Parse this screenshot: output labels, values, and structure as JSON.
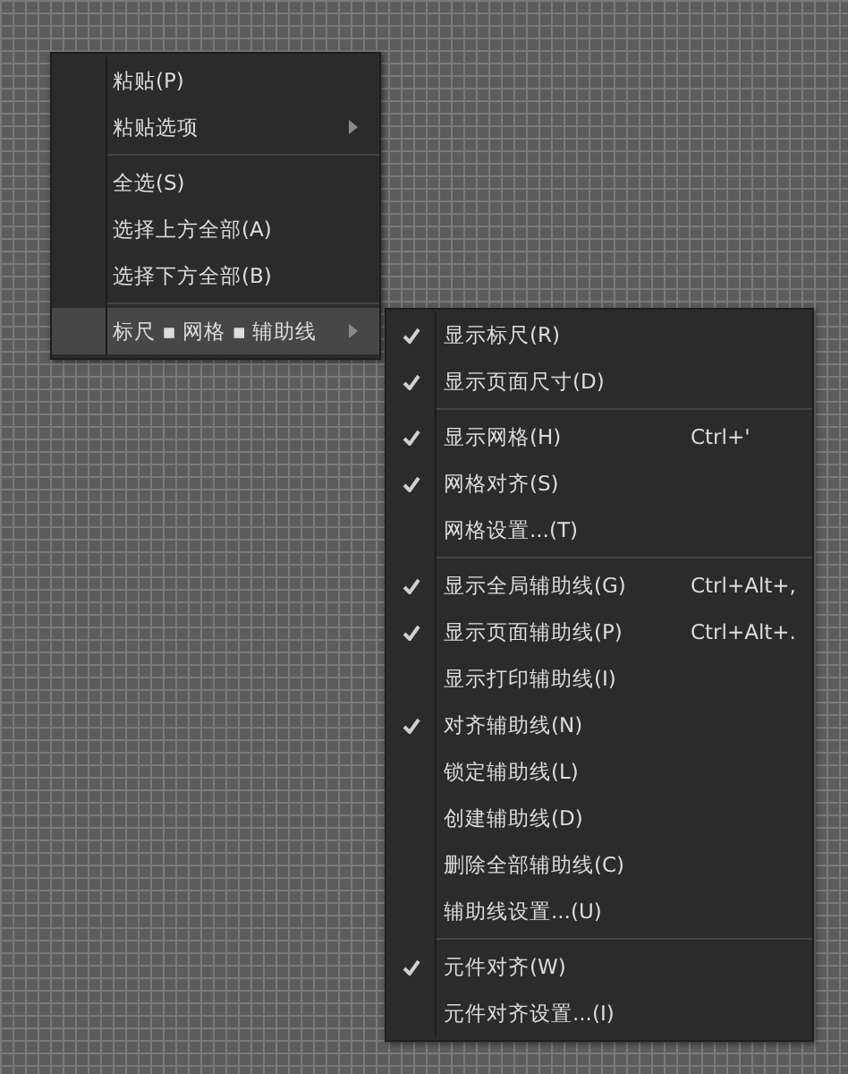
{
  "context_menu": {
    "items": [
      {
        "kind": "item",
        "label": "粘贴(P)",
        "has_submenu": false,
        "highlighted": false
      },
      {
        "kind": "item",
        "label": "粘贴选项",
        "has_submenu": true,
        "highlighted": false
      },
      {
        "kind": "separator"
      },
      {
        "kind": "item",
        "label": "全选(S)",
        "has_submenu": false,
        "highlighted": false
      },
      {
        "kind": "item",
        "label": "选择上方全部(A)",
        "has_submenu": false,
        "highlighted": false
      },
      {
        "kind": "item",
        "label": "选择下方全部(B)",
        "has_submenu": false,
        "highlighted": false
      },
      {
        "kind": "separator"
      },
      {
        "kind": "item",
        "label": "标尺 ▪ 网格 ▪ 辅助线",
        "has_submenu": true,
        "highlighted": true
      }
    ]
  },
  "submenu": {
    "items": [
      {
        "kind": "item",
        "label": "显示标尺(R)",
        "checked": true
      },
      {
        "kind": "item",
        "label": "显示页面尺寸(D)",
        "checked": true
      },
      {
        "kind": "separator"
      },
      {
        "kind": "item",
        "label": "显示网格(H)",
        "checked": true,
        "shortcut": "Ctrl+'"
      },
      {
        "kind": "item",
        "label": "网格对齐(S)",
        "checked": true
      },
      {
        "kind": "item",
        "label": "网格设置...(T)",
        "checked": false
      },
      {
        "kind": "separator"
      },
      {
        "kind": "item",
        "label": "显示全局辅助线(G)",
        "checked": true,
        "shortcut": "Ctrl+Alt+,"
      },
      {
        "kind": "item",
        "label": "显示页面辅助线(P)",
        "checked": true,
        "shortcut": "Ctrl+Alt+."
      },
      {
        "kind": "item",
        "label": "显示打印辅助线(I)",
        "checked": false
      },
      {
        "kind": "item",
        "label": "对齐辅助线(N)",
        "checked": true
      },
      {
        "kind": "item",
        "label": "锁定辅助线(L)",
        "checked": false
      },
      {
        "kind": "item",
        "label": "创建辅助线(D)",
        "checked": false
      },
      {
        "kind": "item",
        "label": "删除全部辅助线(C)",
        "checked": false
      },
      {
        "kind": "item",
        "label": "辅助线设置...(U)",
        "checked": false
      },
      {
        "kind": "separator"
      },
      {
        "kind": "item",
        "label": "元件对齐(W)",
        "checked": true
      },
      {
        "kind": "item",
        "label": "元件对齐设置...(I)",
        "checked": false
      }
    ]
  }
}
